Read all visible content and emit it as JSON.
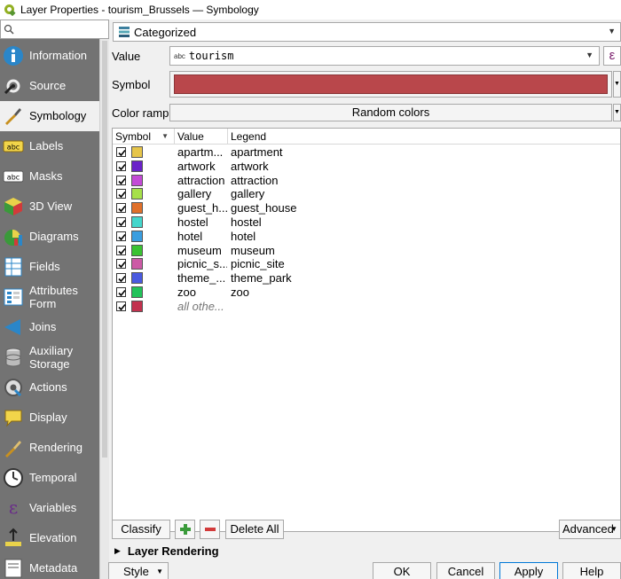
{
  "window": {
    "title": "Layer Properties - tourism_Brussels — Symbology"
  },
  "sidebar": {
    "items": [
      {
        "label": "Information",
        "icon": "information-icon"
      },
      {
        "label": "Source",
        "icon": "source-icon"
      },
      {
        "label": "Symbology",
        "icon": "symbology-icon",
        "active": true
      },
      {
        "label": "Labels",
        "icon": "labels-icon"
      },
      {
        "label": "Masks",
        "icon": "masks-icon"
      },
      {
        "label": "3D View",
        "icon": "3d-view-icon"
      },
      {
        "label": "Diagrams",
        "icon": "diagrams-icon"
      },
      {
        "label": "Fields",
        "icon": "fields-icon"
      },
      {
        "label": "Attributes\nForm",
        "icon": "attributes-form-icon"
      },
      {
        "label": "Joins",
        "icon": "joins-icon"
      },
      {
        "label": "Auxiliary\nStorage",
        "icon": "auxiliary-storage-icon"
      },
      {
        "label": "Actions",
        "icon": "actions-icon"
      },
      {
        "label": "Display",
        "icon": "display-icon"
      },
      {
        "label": "Rendering",
        "icon": "rendering-icon"
      },
      {
        "label": "Temporal",
        "icon": "temporal-icon"
      },
      {
        "label": "Variables",
        "icon": "variables-icon"
      },
      {
        "label": "Elevation",
        "icon": "elevation-icon"
      },
      {
        "label": "Metadata",
        "icon": "metadata-icon"
      }
    ]
  },
  "symbology": {
    "renderer": "Categorized",
    "value_label": "Value",
    "value_abc": "abc",
    "value_field": "tourism",
    "expression_symbol": "ε",
    "symbol_label": "Symbol",
    "symbol_color": "#b9474b",
    "color_ramp_label": "Color ramp",
    "color_ramp_value": "Random colors"
  },
  "table": {
    "headers": [
      "Symbol",
      "Value",
      "Legend"
    ],
    "rows": [
      {
        "value": "apartm...",
        "legend": "apartment",
        "color": "#e6c54a"
      },
      {
        "value": "artwork",
        "legend": "artwork",
        "color": "#6a22c9"
      },
      {
        "value": "attraction",
        "legend": "attraction",
        "color": "#c34ad6"
      },
      {
        "value": "gallery",
        "legend": "gallery",
        "color": "#a6e04a"
      },
      {
        "value": "guest_h...",
        "legend": "guest_house",
        "color": "#e0702a"
      },
      {
        "value": "hostel",
        "legend": "hostel",
        "color": "#44d6cc"
      },
      {
        "value": "hotel",
        "legend": "hotel",
        "color": "#3a9ee0"
      },
      {
        "value": "museum",
        "legend": "museum",
        "color": "#3ac232"
      },
      {
        "value": "picnic_s...",
        "legend": "picnic_site",
        "color": "#cc5aa6"
      },
      {
        "value": "theme_...",
        "legend": "theme_park",
        "color": "#4a5ae0"
      },
      {
        "value": "zoo",
        "legend": "zoo",
        "color": "#22c25a"
      },
      {
        "value": "all othe...",
        "legend": "",
        "color": "#c2324e",
        "other": true
      }
    ]
  },
  "buttons": {
    "classify": "Classify",
    "delete_all": "Delete All",
    "advanced": "Advanced",
    "layer_rendering": "Layer Rendering",
    "style": "Style",
    "ok": "OK",
    "cancel": "Cancel",
    "apply": "Apply",
    "help": "Help"
  }
}
